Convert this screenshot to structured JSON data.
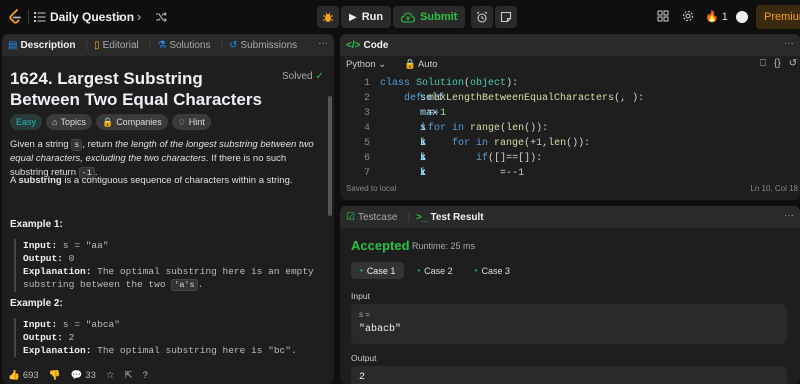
{
  "header": {
    "title": "Daily Question",
    "run_label": "Run",
    "submit_label": "Submit",
    "streak_count": "1",
    "premium_label": "Premium"
  },
  "description": {
    "tabs": [
      {
        "label": "Description",
        "icon": "document-icon"
      },
      {
        "label": "Editorial",
        "icon": "book-icon"
      },
      {
        "label": "Solutions",
        "icon": "flask-icon"
      },
      {
        "label": "Submissions",
        "icon": "history-icon"
      }
    ],
    "title": "1624. Largest Substring Between Two Equal Characters",
    "status": "Solved",
    "chips": [
      {
        "label": "Easy"
      },
      {
        "label": "Topics"
      },
      {
        "label": "Companies"
      },
      {
        "label": "Hint"
      }
    ],
    "para1": {
      "p1": "Given a string ",
      "code1": "s",
      "p2": ", return ",
      "em": "the length of the longest substring between two equal characters, excluding the two characters",
      "p3": ". If there is no such substring return ",
      "code2": "-1",
      "p4": "."
    },
    "para2": {
      "p1": "A ",
      "strong": "substring",
      "p2": " is a contiguous sequence of characters within a string."
    },
    "example1": {
      "title": "Example 1:",
      "input_label": "Input:",
      "input": " s = \"aa\"",
      "output_label": "Output:",
      "output": " 0",
      "expl_label": "Explanation:",
      "expl1": " The optimal substring here is an empty",
      "expl2": "substring between the two ",
      "expl_code": "'a's",
      "expl3": "."
    },
    "example2": {
      "title": "Example 2:",
      "input_label": "Input:",
      "input": " s = \"abca\"",
      "output_label": "Output:",
      "output": " 2",
      "expl_label": "Explanation:",
      "expl1": " The optimal substring here is \"bc\"."
    },
    "footer": {
      "likes": "693",
      "comments": "33"
    }
  },
  "code": {
    "tab_label": "Code",
    "language": "Python",
    "mode": "Auto",
    "lines": [
      {
        "n": "1",
        "indent": "",
        "parts": [
          [
            "kw",
            "class "
          ],
          [
            "bl",
            "Solution"
          ],
          [
            "op",
            "("
          ],
          [
            "bl",
            "object"
          ],
          [
            "op",
            "):"
          ]
        ]
      },
      {
        "n": "2",
        "indent": "    ",
        "parts": [
          [
            "kw",
            "def "
          ],
          [
            "fn",
            "maxLengthBetweenEqualCharacters"
          ],
          [
            "op",
            "("
          ],
          [
            "ct",
            "self"
          ],
          [
            "op",
            ", "
          ],
          [
            "ct",
            "s"
          ],
          [
            "op",
            "):"
          ]
        ]
      },
      {
        "n": "3",
        "indent": "        ",
        "parts": [
          [
            "ct",
            "max"
          ],
          [
            "op",
            "=-"
          ],
          [
            "num",
            "1"
          ]
        ]
      },
      {
        "n": "4",
        "indent": "        ",
        "parts": [
          [
            "kw",
            "for "
          ],
          [
            "ct",
            "i "
          ],
          [
            "kw",
            "in "
          ],
          [
            "fn",
            "range"
          ],
          [
            "op",
            "("
          ],
          [
            "fn",
            "len"
          ],
          [
            "op",
            "("
          ],
          [
            "ct",
            "s"
          ],
          [
            "op",
            "))"
          ],
          [
            "op",
            ":"
          ]
        ]
      },
      {
        "n": "5",
        "indent": "            ",
        "parts": [
          [
            "kw",
            "for "
          ],
          [
            "ct",
            "k "
          ],
          [
            "kw",
            "in "
          ],
          [
            "fn",
            "range"
          ],
          [
            "op",
            "("
          ],
          [
            "ct",
            "i"
          ],
          [
            "op",
            "+"
          ],
          [
            "num",
            "1"
          ],
          [
            "op",
            ","
          ],
          [
            "fn",
            "len"
          ],
          [
            "op",
            "("
          ],
          [
            "ct",
            "s"
          ],
          [
            "op",
            "))"
          ],
          [
            "op",
            ":"
          ]
        ]
      },
      {
        "n": "6",
        "indent": "                ",
        "parts": [
          [
            "kw",
            "if"
          ],
          [
            "op",
            "("
          ],
          [
            "ct",
            "s"
          ],
          [
            "op",
            "["
          ],
          [
            "ct",
            "i"
          ],
          [
            "op",
            "]=="
          ],
          [
            "ct",
            "s"
          ],
          [
            "op",
            "["
          ],
          [
            "ct",
            "k"
          ],
          [
            "op",
            "]):"
          ]
        ]
      },
      {
        "n": "7",
        "indent": "                    ",
        "parts": [
          [
            "ct",
            "x"
          ],
          [
            "op",
            "="
          ],
          [
            "ct",
            "k"
          ],
          [
            "op",
            "-"
          ],
          [
            "ct",
            "i"
          ],
          [
            "op",
            "-"
          ],
          [
            "num",
            "1"
          ]
        ]
      }
    ],
    "saved_label": "Saved to local",
    "cursor": "Ln 10, Col 18"
  },
  "test": {
    "tabs": [
      {
        "label": "Testcase",
        "icon": "checkbox-icon"
      },
      {
        "label": "Test Result",
        "icon": "terminal-icon"
      }
    ],
    "verdict": "Accepted",
    "runtime": "Runtime: 25 ms",
    "cases": [
      "Case 1",
      "Case 2",
      "Case 3"
    ],
    "input_label": "Input",
    "input_key": "s =",
    "input_value": "\"abacb\"",
    "output_label": "Output",
    "output_value": "2"
  },
  "colors": {
    "accent": "#ffa116",
    "accepted": "#28c244",
    "easy": "#1cbaba",
    "panel": "#1e1e1e",
    "background": "#0f0f0f"
  }
}
